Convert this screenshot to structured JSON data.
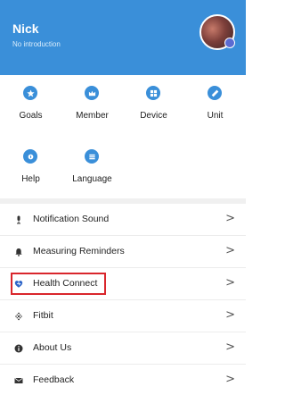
{
  "profile": {
    "name": "Nick",
    "intro": "No introduction",
    "avatar_icon": "user-photo-avatar"
  },
  "grid": [
    {
      "label": "Goals",
      "icon": "star-icon"
    },
    {
      "label": "Member",
      "icon": "crown-icon"
    },
    {
      "label": "Device",
      "icon": "device-grid-icon"
    },
    {
      "label": "Unit",
      "icon": "ruler-icon"
    },
    {
      "label": "Help",
      "icon": "question-icon"
    },
    {
      "label": "Language",
      "icon": "globe-icon"
    }
  ],
  "list": [
    {
      "label": "Notification Sound",
      "icon": "microphone-icon",
      "chevron": ">"
    },
    {
      "label": "Measuring Reminders",
      "icon": "bell-icon",
      "chevron": ">"
    },
    {
      "label": "Health Connect",
      "icon": "health-connect-icon",
      "chevron": ">",
      "highlighted": true
    },
    {
      "label": "Fitbit",
      "icon": "fitbit-icon",
      "chevron": ">"
    },
    {
      "label": "About Us",
      "icon": "info-icon",
      "chevron": ">"
    },
    {
      "label": "Feedback",
      "icon": "mail-icon",
      "chevron": ">"
    }
  ],
  "colors": {
    "header": "#3a8fd9",
    "highlight": "#d9262c"
  }
}
